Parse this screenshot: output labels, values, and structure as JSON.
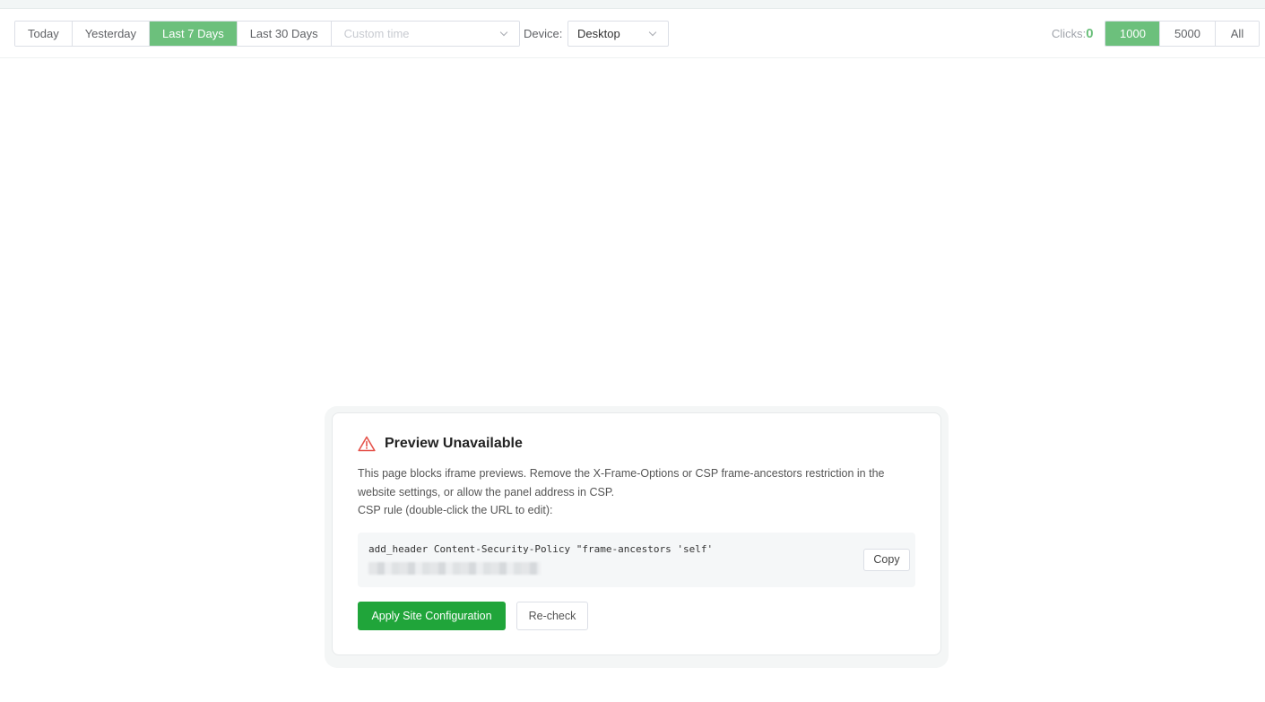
{
  "toolbar": {
    "ranges": [
      "Today",
      "Yesterday",
      "Last 7 Days",
      "Last 30 Days"
    ],
    "active_range": "Last 7 Days",
    "custom_time_placeholder": "Custom time",
    "device_label": "Device:",
    "device_value": "Desktop",
    "clicks_label": "Clicks:",
    "clicks_value": "0",
    "limits": [
      "1000",
      "5000",
      "All"
    ],
    "active_limit": "1000"
  },
  "notice": {
    "title": "Preview Unavailable",
    "description": "This page blocks iframe previews. Remove the X-Frame-Options or CSP frame-ancestors restriction in the website settings, or allow the panel address in CSP.",
    "csp_hint": "CSP rule (double-click the URL to edit):",
    "code": "add_header Content-Security-Policy \"frame-ancestors 'self'",
    "copy_label": "Copy",
    "apply_label": "Apply Site Configuration",
    "recheck_label": "Re-check"
  },
  "colors": {
    "accent": "#6cc07c",
    "primary_button": "#20a53a",
    "warning": "#e5534b"
  }
}
